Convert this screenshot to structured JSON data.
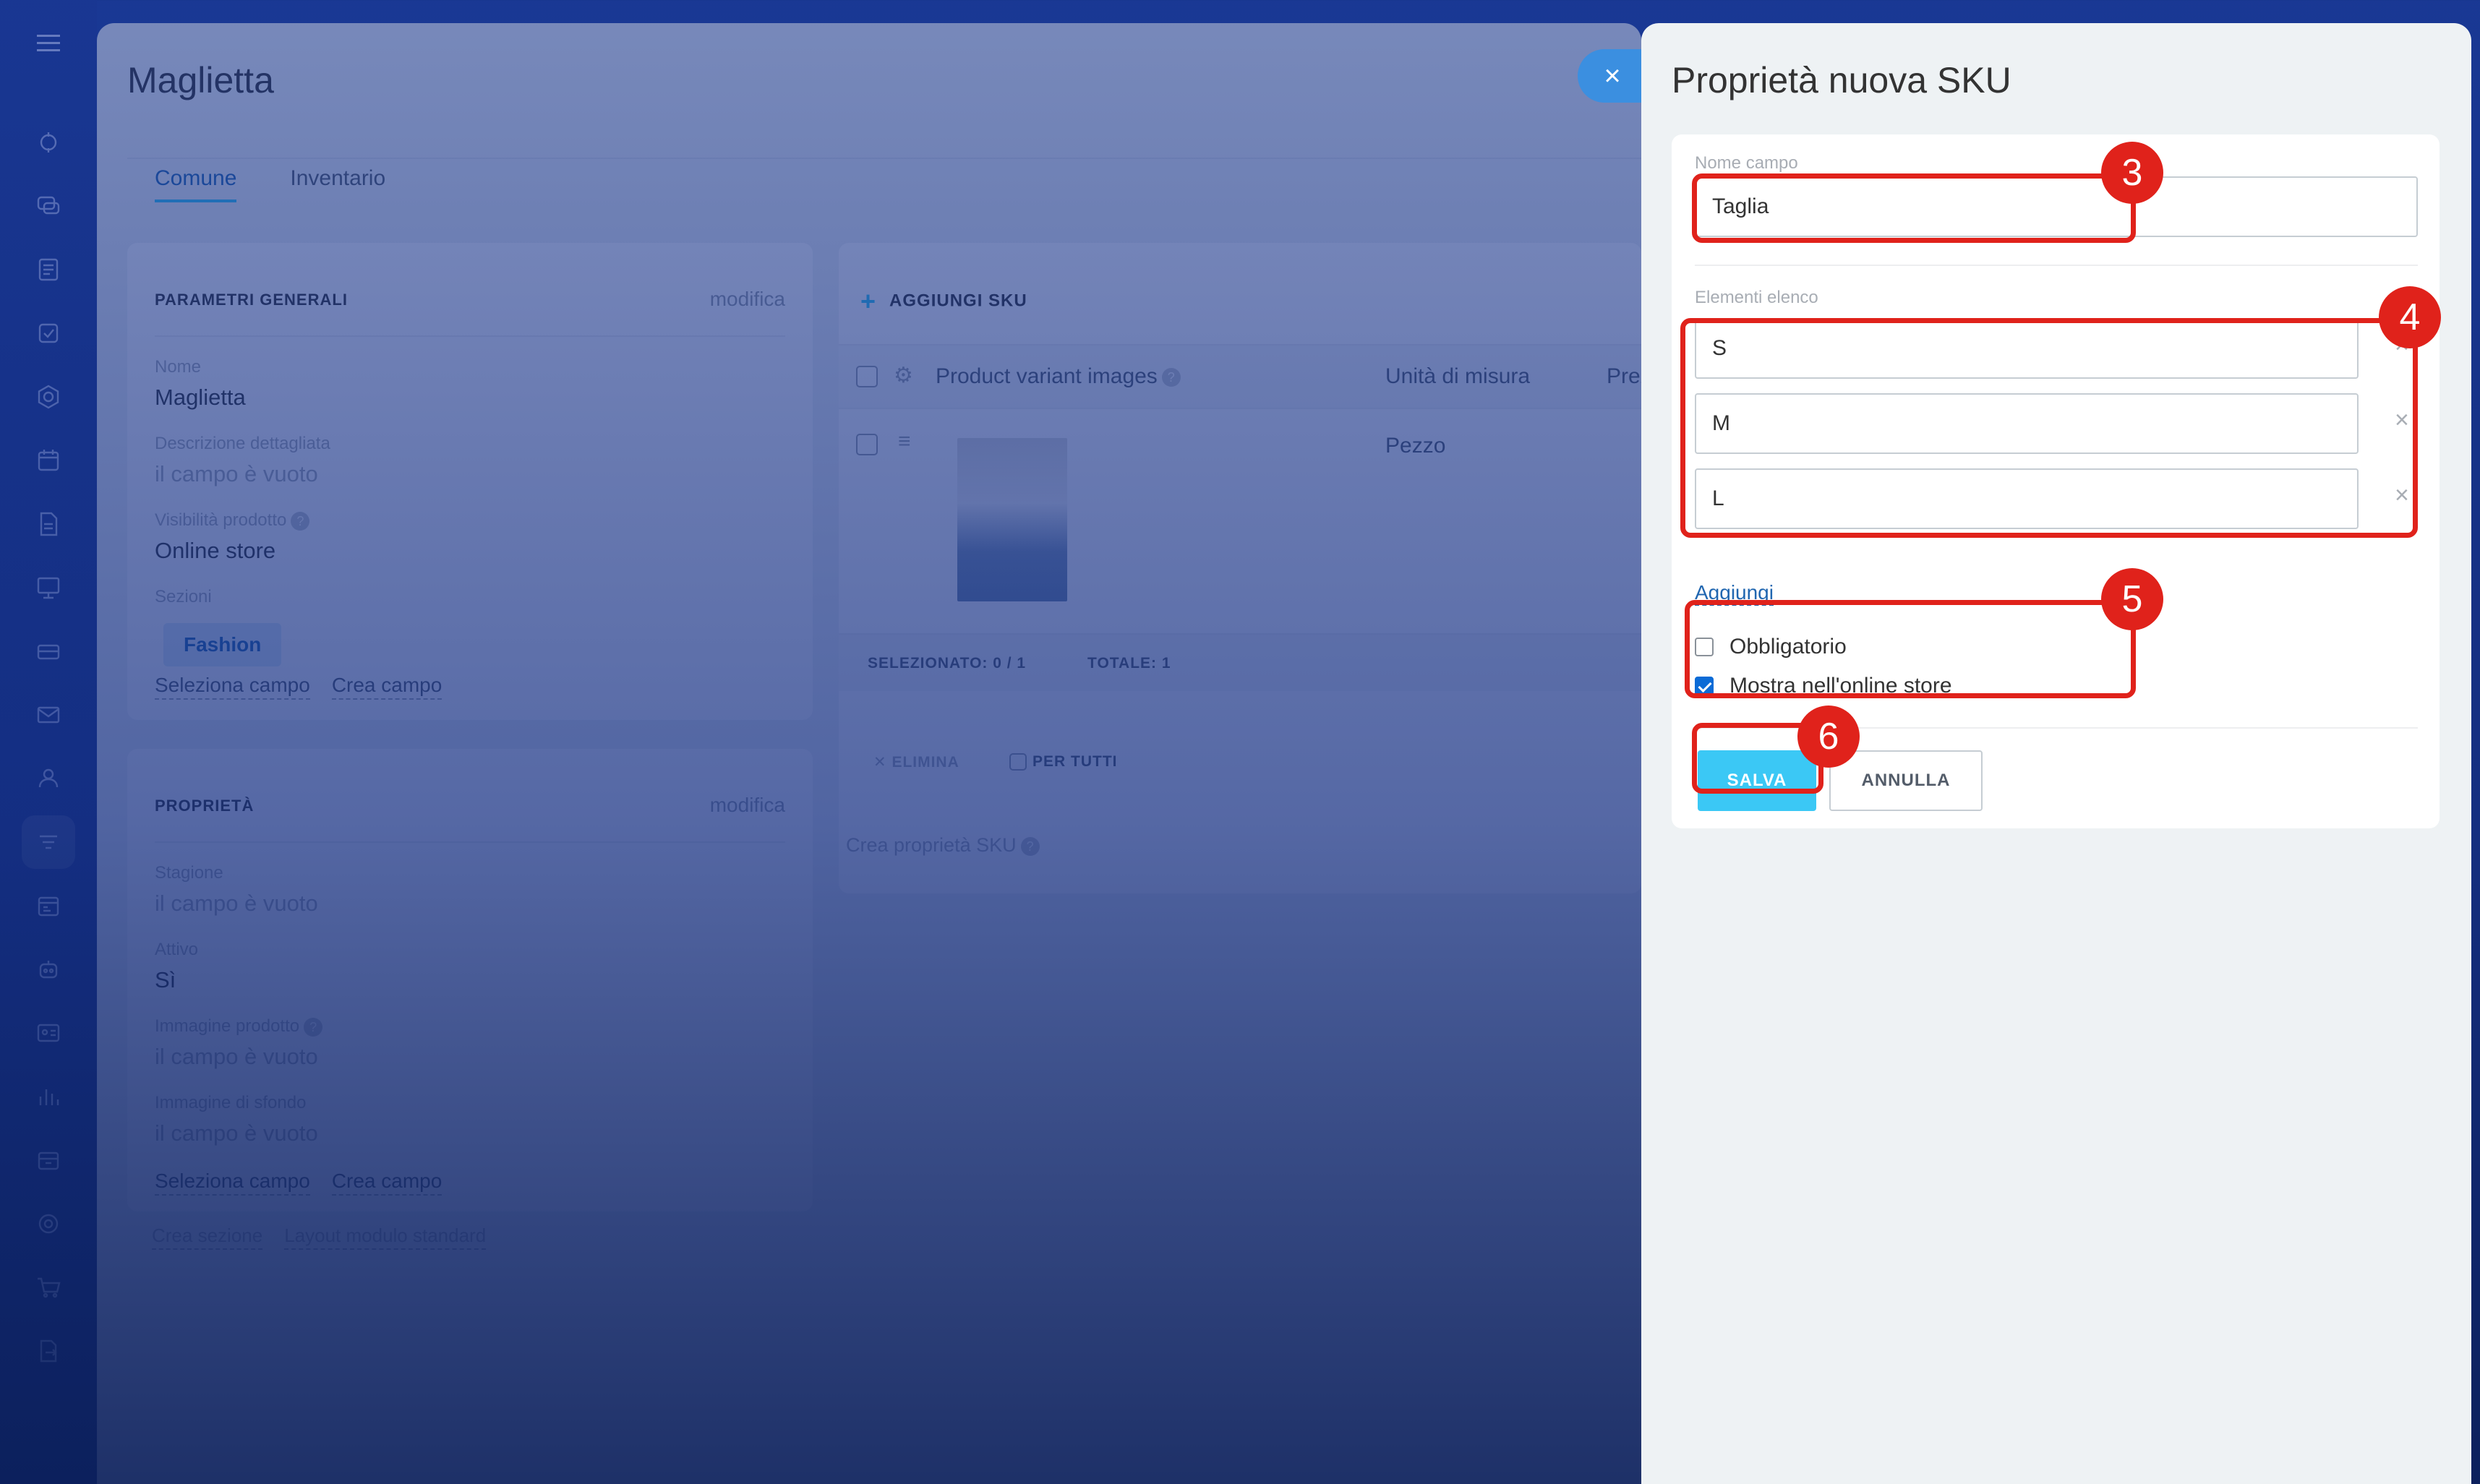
{
  "rail": {
    "icons": [
      "menu-icon",
      "activity-icon",
      "chat-icon",
      "feed-icon",
      "tasks-icon",
      "hexagon-icon",
      "calendar-icon",
      "document-icon",
      "presentation-icon",
      "store-icon",
      "mail-icon",
      "users-icon",
      "funnel-icon",
      "schedule-icon",
      "robot-icon",
      "contact-card-icon",
      "chart-icon",
      "archive-icon",
      "target-icon",
      "cart-icon",
      "export-icon"
    ]
  },
  "product": {
    "title": "Maglietta",
    "tabs": [
      {
        "label": "Comune"
      },
      {
        "label": "Inventario"
      }
    ],
    "general": {
      "title": "PARAMETRI GENERALI",
      "edit": "modifica",
      "name_label": "Nome",
      "name_value": "Maglietta",
      "desc_label": "Descrizione dettagliata",
      "desc_value": "il campo è vuoto",
      "visibility_label": "Visibilità prodotto",
      "visibility_value": "Online store",
      "sections_label": "Sezioni",
      "section_chip": "Fashion",
      "select_field": "Seleziona campo",
      "create_field": "Crea campo"
    },
    "properties": {
      "title": "PROPRIETÀ",
      "edit": "modifica",
      "season_label": "Stagione",
      "season_value": "il campo è vuoto",
      "active_label": "Attivo",
      "active_value": "Sì",
      "image_label": "Immagine prodotto",
      "image_value": "il campo è vuoto",
      "bg_label": "Immagine di sfondo",
      "bg_value": "il campo è vuoto",
      "select_field": "Seleziona campo",
      "create_field": "Crea campo",
      "create_section": "Crea sezione",
      "standard_layout": "Layout modulo standard"
    },
    "sku": {
      "add_label": "AGGIUNGI SKU",
      "col_images": "Product variant images",
      "col_unit": "Unità di misura",
      "col_price": "Prez",
      "row_unit": "Pezzo",
      "selected_label": "SELEZIONATO:",
      "selected_value": "0 / 1",
      "total_label": "TOTALE:",
      "total_value": "1",
      "delete": "ELIMINA",
      "for_all": "PER TUTTI",
      "create_prop": "Crea proprietà SKU"
    }
  },
  "slider": {
    "title": "Proprietà nuova SKU",
    "field_name_label": "Nome campo",
    "field_name_value": "Taglia",
    "list_label": "Elementi elenco",
    "list_items": [
      {
        "value": "S"
      },
      {
        "value": "M"
      },
      {
        "value": "L"
      }
    ],
    "remove_glyph": "×",
    "add_link": "Aggiungi",
    "required_label": "Obbligatorio",
    "required_checked": false,
    "show_store_label": "Mostra nell'online store",
    "show_store_checked": true,
    "save": "SALVA",
    "cancel": "ANNULLA",
    "close_glyph": "×"
  },
  "annotations": {
    "badge_3": "3",
    "badge_4": "4",
    "badge_5": "5",
    "badge_6": "6",
    "color": "#e0221b"
  }
}
